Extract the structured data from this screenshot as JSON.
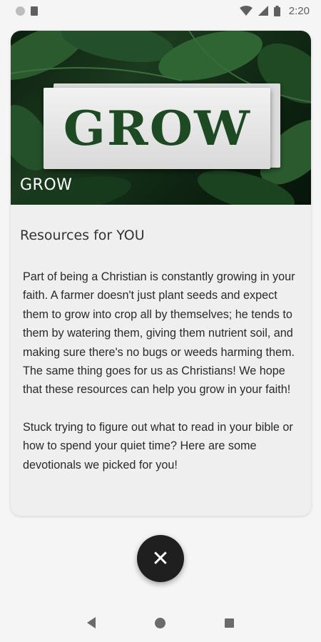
{
  "status_bar": {
    "time": "2:20",
    "icons": [
      "notification-dot-icon",
      "sim-card-icon",
      "wifi-icon",
      "signal-icon",
      "battery-icon"
    ]
  },
  "card": {
    "hero": {
      "overlay_word": "GROW",
      "caption": "GROW"
    },
    "section_title": "Resources for YOU",
    "paragraphs": [
      "Part of being a Christian is constantly growing in your faith. A farmer doesn't just plant seeds and expect them to grow into crop all by themselves; he tends to them by watering them, giving them nutrient soil, and making sure there's no bugs or weeds harming them. The same thing goes for us as Christians! We hope that these resources can help you grow in your faith!",
      "Stuck trying to figure out what to read in your bible or how to spend your quiet time? Here are some devotionals we picked for you!"
    ]
  },
  "fab": {
    "icon": "close-icon",
    "glyph": "✕"
  },
  "nav_bar": {
    "icons": [
      "back-icon",
      "home-icon",
      "recents-icon"
    ]
  },
  "colors": {
    "grow_text": "#1d4a22",
    "fab_bg": "#1f1f1f",
    "card_bg": "#efefef"
  }
}
